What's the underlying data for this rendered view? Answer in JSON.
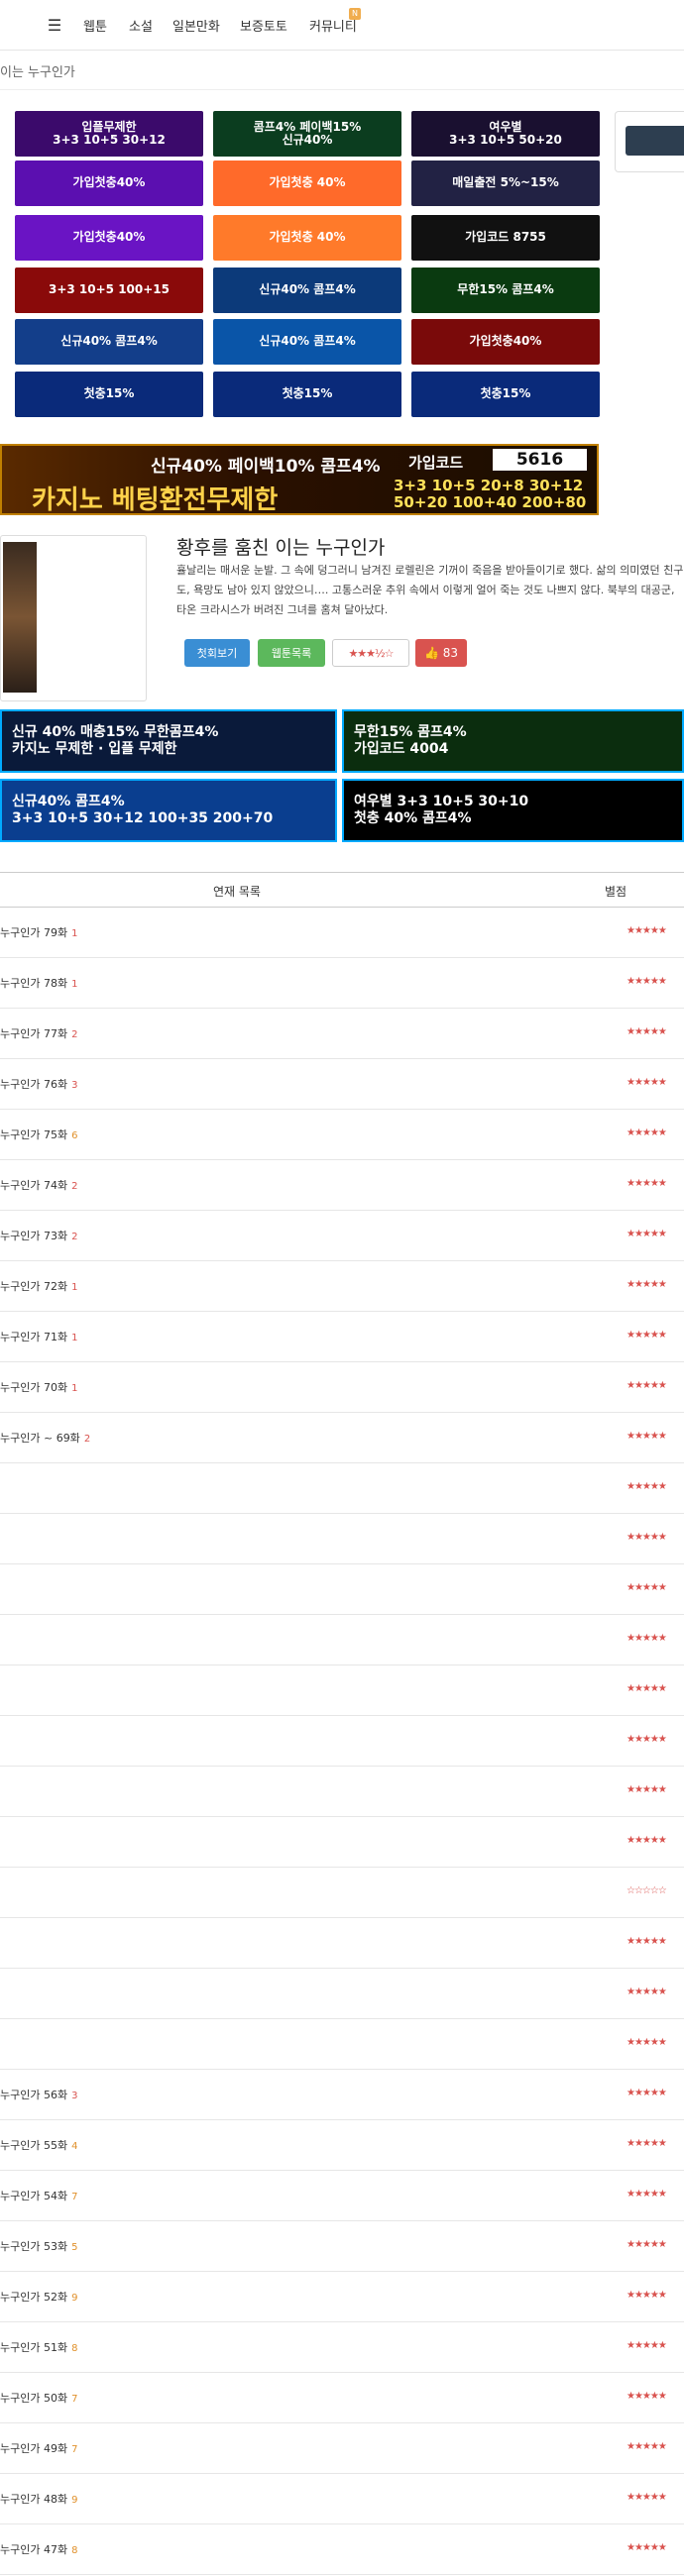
{
  "nav": {
    "items": [
      "웹툰",
      "소설",
      "일본만화",
      "보증토토",
      "커뮤니티"
    ],
    "badge": "N"
  },
  "breadcrumb": "이는 누구인가",
  "top_banners": [
    {
      "text": "입플무제한\n3+3 10+5 30+12",
      "bg": "#3b0a6b"
    },
    {
      "text": "콤프4% 페이백15%\n신규40%",
      "bg": "#0b3d1f"
    },
    {
      "text": "여우별\n3+3 10+5 50+20",
      "bg": "#1a1030"
    },
    {
      "text": "가입첫충40%",
      "bg": "#5b0fb0"
    },
    {
      "text": "가입첫충 40%",
      "bg": "#ff6a2a"
    },
    {
      "text": "매일출전 5%~15%",
      "bg": "#222244"
    },
    {
      "text": "가입첫충40%",
      "bg": "#6a14c4"
    },
    {
      "text": "가입첫충 40%",
      "bg": "#ff7a2a"
    },
    {
      "text": "가입코드 8755",
      "bg": "#111"
    },
    {
      "text": "3+3 10+5 100+15",
      "bg": "#8a0a0a"
    },
    {
      "text": "신규40% 콤프4%",
      "bg": "#0c3a7a"
    },
    {
      "text": "무한15% 콤프4%",
      "bg": "#0a3a10"
    },
    {
      "text": "신규40% 콤프4%",
      "bg": "#133e8a"
    },
    {
      "text": "신규40% 콤프4%",
      "bg": "#0a55a8"
    },
    {
      "text": "가입첫충40%",
      "bg": "#7a0a0a"
    },
    {
      "text": "첫충15%",
      "bg": "#0a2a7a"
    },
    {
      "text": "첫충15%",
      "bg": "#0a2a7a"
    },
    {
      "text": "첫충15%",
      "bg": "#0a2a7a"
    }
  ],
  "wide_banner": {
    "line1": "신규40% 페이백10% 콤프4%",
    "line2": "카지노 베팅환전무제한",
    "code_label": "가입코드",
    "code": "5616",
    "nums": "3+3 10+5 20+8 30+12\n50+20 100+40 200+80"
  },
  "series": {
    "title": "황후를 훔친 이는 누구인가",
    "description": "휼날리는 매서운 눈발. 그 속에 덩그러니 남겨진 로렐린은 기꺼이 죽음을 받아들이기로 했다. 삶의 의미였던 친구도, 욕망도 남아 있지 않았으니…. 고통스러운 추위 속에서 이렇게 얼어 죽는 것도 나쁘지 않다. 북부의 대공군, 타온 크라시스가 버려진 그녀를 홈쳐 달아났다.",
    "first_btn": "첫회보기",
    "list_btn": "웹툰목록",
    "rating": "★★★½☆",
    "likes": "83"
  },
  "mid_banners": [
    {
      "text": "신규 40% 매충15% 무한콤프4%\n카지노 무제한 · 입플 무제한",
      "bg": "#0a1a3a"
    },
    {
      "text": "무한15% 콤프4%\n가입코드 4004",
      "bg": "#0b2d0e"
    },
    {
      "text": "신규40% 콤프4%\n3+3 10+5 30+12 100+35 200+70",
      "bg": "#0a3e8f"
    },
    {
      "text": "여우별 3+3 10+5 30+10\n첫충 40% 콤프4%",
      "bg": "#000"
    }
  ],
  "table": {
    "col_title": "연재 목록",
    "col_rating": "별점",
    "rows": [
      {
        "title": "누구인가 79화",
        "n": "1",
        "stars": "★★★★★"
      },
      {
        "title": "누구인가 78화",
        "n": "1",
        "stars": "★★★★★"
      },
      {
        "title": "누구인가 77화",
        "n": "2",
        "stars": "★★★★★"
      },
      {
        "title": "누구인가 76화",
        "n": "3",
        "stars": "★★★★★"
      },
      {
        "title": "누구인가 75화",
        "n": "6",
        "stars": "★★★★★"
      },
      {
        "title": "누구인가 74화",
        "n": "2",
        "stars": "★★★★★"
      },
      {
        "title": "누구인가 73화",
        "n": "2",
        "stars": "★★★★★"
      },
      {
        "title": "누구인가 72화",
        "n": "1",
        "stars": "★★★★★"
      },
      {
        "title": "누구인가 71화",
        "n": "1",
        "stars": "★★★★★"
      },
      {
        "title": "누구인가 70화",
        "n": "1",
        "stars": "★★★★★"
      },
      {
        "title": "누구인가 ~ 69화",
        "n": "2",
        "stars": "★★★★★"
      },
      {
        "title": "",
        "n": "",
        "stars": "★★★★★"
      },
      {
        "title": "",
        "n": "",
        "stars": "★★★★★"
      },
      {
        "title": "",
        "n": "",
        "stars": "★★★★★"
      },
      {
        "title": "",
        "n": "",
        "stars": "★★★★★"
      },
      {
        "title": "",
        "n": "",
        "stars": "★★★★★"
      },
      {
        "title": "",
        "n": "",
        "stars": "★★★★★"
      },
      {
        "title": "",
        "n": "",
        "stars": "★★★★★"
      },
      {
        "title": "",
        "n": "",
        "stars": "★★★★★"
      },
      {
        "title": "",
        "n": "",
        "stars": "☆☆☆☆☆"
      },
      {
        "title": "",
        "n": "",
        "stars": "★★★★★"
      },
      {
        "title": "",
        "n": "",
        "stars": "★★★★★"
      },
      {
        "title": "",
        "n": "",
        "stars": "★★★★★"
      },
      {
        "title": "누구인가 56화",
        "n": "3",
        "stars": "★★★★★"
      },
      {
        "title": "누구인가 55화",
        "n": "4",
        "stars": "★★★★★"
      },
      {
        "title": "누구인가 54화",
        "n": "7",
        "stars": "★★★★★"
      },
      {
        "title": "누구인가 53화",
        "n": "5",
        "stars": "★★★★★"
      },
      {
        "title": "누구인가 52화",
        "n": "9",
        "stars": "★★★★★"
      },
      {
        "title": "누구인가 51화",
        "n": "8",
        "stars": "★★★★★"
      },
      {
        "title": "누구인가 50화",
        "n": "7",
        "stars": "★★★★★"
      },
      {
        "title": "누구인가 49화",
        "n": "7",
        "stars": "★★★★★"
      },
      {
        "title": "누구인가 48화",
        "n": "9",
        "stars": "★★★★★"
      },
      {
        "title": "누구인가 47화",
        "n": "8",
        "stars": "★★★★★"
      }
    ]
  },
  "colors": {
    "accent_red": "#d9534f",
    "btn_blue": "#3a8ed4",
    "btn_green": "#5cb85c"
  }
}
